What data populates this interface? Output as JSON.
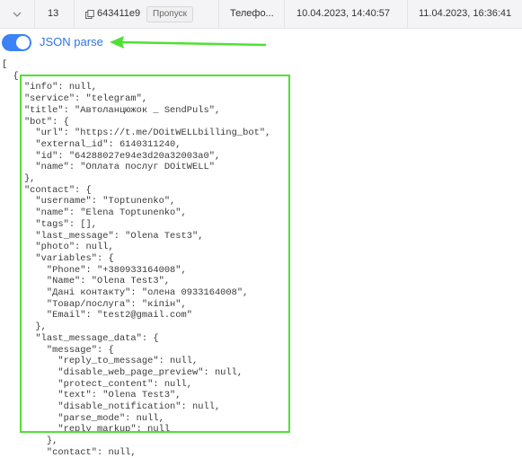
{
  "row": {
    "index": "13",
    "id_text": "643411e9",
    "status_badge": "Пропуск",
    "channel": "Телефо...",
    "created": "10.04.2023, 14:40:57",
    "updated": "11.04.2023, 16:36:41"
  },
  "toggle": {
    "label": "JSON parse",
    "checked": true
  },
  "colors": {
    "accent": "#3b82f6",
    "highlight": "#4fe035"
  },
  "json_lines": [
    "[",
    "  {",
    "    \"info\": null,",
    "    \"service\": \"telegram\",",
    "    \"title\": \"Автоланцюжок _ SendPuls\",",
    "    \"bot\": {",
    "      \"url\": \"https://t.me/DOitWELLbilling_bot\",",
    "      \"external_id\": 6140311240,",
    "      \"id\": \"64288027e94e3d20a32003a0\",",
    "      \"name\": \"Оплата послуг DOitWELL\"",
    "    },",
    "    \"contact\": {",
    "      \"username\": \"Toptunenko\",",
    "      \"name\": \"Elena Toptunenko\",",
    "      \"tags\": [],",
    "      \"last_message\": \"Olena Test3\",",
    "      \"photo\": null,",
    "      \"variables\": {",
    "        \"Phone\": \"+380933164008\",",
    "        \"Name\": \"Olena Test3\",",
    "        \"Дані контакту\": \"олена 0933164008\",",
    "        \"Товар/послуга\": \"кіпін\",",
    "        \"Email\": \"test2@gmail.com\"",
    "      },",
    "      \"last_message_data\": {",
    "        \"message\": {",
    "          \"reply_to_message\": null,",
    "          \"disable_web_page_preview\": null,",
    "          \"protect_content\": null,",
    "          \"text\": \"Olena Test3\",",
    "          \"disable_notification\": null,",
    "          \"parse_mode\": null,",
    "          \"reply_markup\": null",
    "        },",
    "        \"contact\": null,"
  ]
}
